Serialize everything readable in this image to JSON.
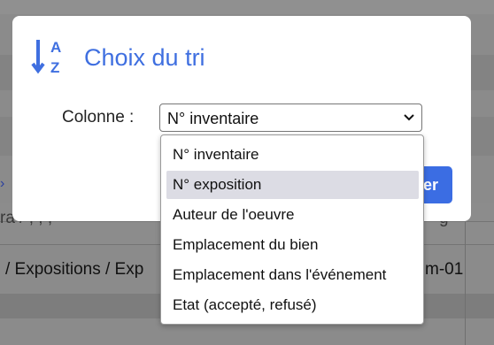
{
  "background": {
    "path_text": "/ Expositions / Exp",
    "path_suffix": "m-01",
    "fragment_left": "ra / , , ,",
    "fragment_right": "g"
  },
  "modal": {
    "title": "Choix du tri",
    "icon_name": "sort-alpha-down-icon",
    "accent_color": "#3f6fe0",
    "column_label": "Colonne :",
    "select": {
      "selected_value": "N° inventaire"
    },
    "validate_label": "er",
    "validate_color": "#3b6de3"
  },
  "dropdown": {
    "options": [
      {
        "label": "N° inventaire"
      },
      {
        "label": "N° exposition"
      },
      {
        "label": "Auteur de l'oeuvre"
      },
      {
        "label": "Emplacement du bien"
      },
      {
        "label": "Emplacement dans l'événement"
      },
      {
        "label": "Etat (accepté, refusé)"
      }
    ],
    "hovered_option": "N° exposition"
  }
}
